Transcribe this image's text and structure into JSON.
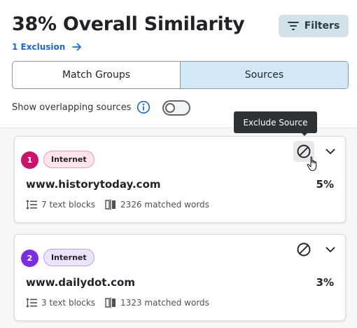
{
  "header": {
    "title": "38% Overall Similarity",
    "filters_label": "Filters",
    "exclusion_link": "1 Exclusion"
  },
  "tabs": [
    {
      "label": "Match Groups",
      "active": false
    },
    {
      "label": "Sources",
      "active": true
    }
  ],
  "overlap": {
    "label": "Show overlapping sources",
    "enabled": false
  },
  "tooltip": "Exclude Source",
  "sources": [
    {
      "number": "1",
      "badge_color": "#c8146d",
      "type": "Internet",
      "tag_bg": "#fde3ea",
      "tag_border": "#e0a0b4",
      "name": "www.historytoday.com",
      "percent": "5%",
      "text_blocks": "7 text blocks",
      "matched_words": "2326 matched words"
    },
    {
      "number": "2",
      "badge_color": "#7a2ee0",
      "type": "Internet",
      "tag_bg": "#ede3fd",
      "tag_border": "#b8a2e6",
      "name": "www.dailydot.com",
      "percent": "3%",
      "text_blocks": "3 text blocks",
      "matched_words": "1323 matched words"
    }
  ],
  "icons": {
    "filters": "filter-lines-icon",
    "exclusion": "arrow-right-icon",
    "info": "info-circle-icon",
    "exclude": "block-circle-icon",
    "expand": "chevron-down-icon",
    "text_blocks": "list-lines-icon",
    "matched_words": "compare-doc-icon"
  },
  "colors": {
    "link": "#1d68c9",
    "active_tab": "#d3e8f6",
    "filters_bg": "#d3e2e9"
  }
}
